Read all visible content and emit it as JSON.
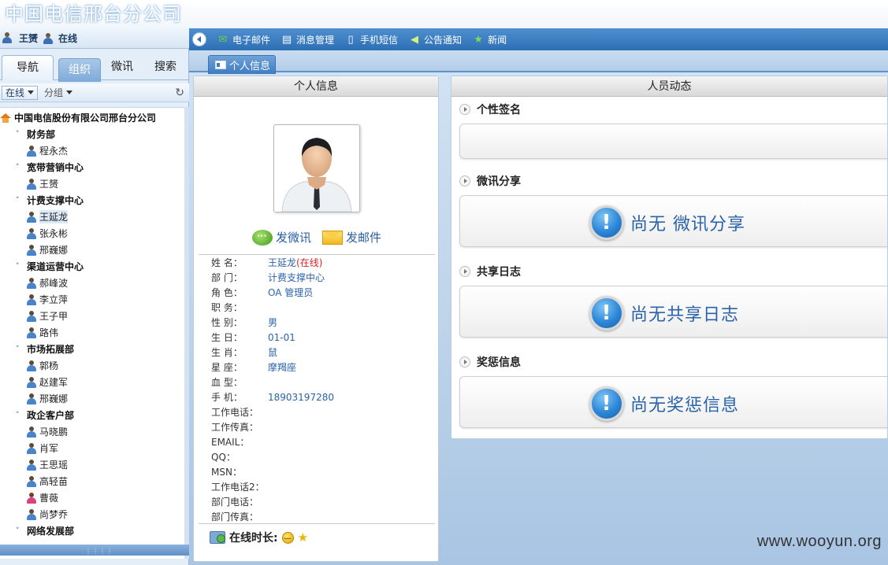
{
  "banner": {
    "title": "中国电信邢台分公司"
  },
  "user_bar": {
    "name": "王赟",
    "status": "在线"
  },
  "top_nav": {
    "items": [
      {
        "label": "电子邮件",
        "icon": "mail-icon",
        "color": "#6bd04a"
      },
      {
        "label": "消息管理",
        "icon": "message-list-icon",
        "color": "#ffffff"
      },
      {
        "label": "手机短信",
        "icon": "phone-icon",
        "color": "#ffffff"
      },
      {
        "label": "公告通知",
        "icon": "announcement-icon",
        "color": "#d6f07a"
      },
      {
        "label": "新闻",
        "icon": "news-icon",
        "color": "#7fd65a"
      }
    ]
  },
  "sidebar": {
    "tabs": [
      "导航",
      "组织",
      "微讯",
      "搜索"
    ],
    "active_tab": "组织",
    "filter_status": "在线",
    "filter_group": "分组",
    "tree": {
      "root": "中国电信股份有限公司邢台分公司",
      "departments": [
        {
          "name": "财务部",
          "members": [
            {
              "name": "程永杰"
            }
          ]
        },
        {
          "name": "宽带营销中心",
          "members": [
            {
              "name": "王赟"
            }
          ]
        },
        {
          "name": "计费支撑中心",
          "members": [
            {
              "name": "王延龙",
              "selected": true
            },
            {
              "name": "张永彬"
            },
            {
              "name": "邢巍娜"
            }
          ]
        },
        {
          "name": "渠道运营中心",
          "members": [
            {
              "name": "郝峰波"
            },
            {
              "name": "李立萍"
            },
            {
              "name": "王子甲"
            },
            {
              "name": "路伟"
            }
          ]
        },
        {
          "name": "市场拓展部",
          "members": [
            {
              "name": "郭杨"
            },
            {
              "name": "赵建军"
            },
            {
              "name": "邢巍娜"
            }
          ]
        },
        {
          "name": "政企客户部",
          "members": [
            {
              "name": "马晓鹏"
            },
            {
              "name": "肖军"
            },
            {
              "name": "王思瑶"
            },
            {
              "name": "高轻苗"
            },
            {
              "name": "曹薇",
              "female": true
            },
            {
              "name": "尚梦乔"
            }
          ]
        },
        {
          "name": "网络发展部",
          "members": []
        }
      ]
    }
  },
  "content_tabs": [
    {
      "label": "个人信息"
    }
  ],
  "info_panel": {
    "title": "个人信息",
    "actions": {
      "weixun": "发微讯",
      "mail": "发邮件"
    },
    "fields": [
      {
        "label": "姓 名：",
        "value": "王延龙",
        "status": "(在线)"
      },
      {
        "label": "部 门：",
        "value": "计费支撑中心"
      },
      {
        "label": "角 色：",
        "value": "OA 管理员"
      },
      {
        "label": "职 务：",
        "value": ""
      },
      {
        "label": "性 别：",
        "value": "男"
      },
      {
        "label": "生 日：",
        "value": "01-01"
      },
      {
        "label": "生 肖：",
        "value": "鼠"
      },
      {
        "label": "星 座：",
        "value": "摩羯座"
      },
      {
        "label": "血 型：",
        "value": ""
      },
      {
        "label": "手 机：",
        "value": "18903197280"
      },
      {
        "label": "工作电话：",
        "value": ""
      },
      {
        "label": "工作传真：",
        "value": ""
      },
      {
        "label": "EMAIL：",
        "value": ""
      },
      {
        "label": "QQ：",
        "value": ""
      },
      {
        "label": "MSN：",
        "value": ""
      },
      {
        "label": "工作电话2：",
        "value": ""
      },
      {
        "label": "部门电话：",
        "value": ""
      },
      {
        "label": "部门传真：",
        "value": ""
      }
    ],
    "online_label": "在线时长:"
  },
  "activity_panel": {
    "title": "人员动态",
    "sections": [
      {
        "title": "个性签名",
        "message": ""
      },
      {
        "title": "微讯分享",
        "message": "尚无 微讯分享"
      },
      {
        "title": "共享日志",
        "message": "尚无共享日志"
      },
      {
        "title": "奖惩信息",
        "message": "尚无奖惩信息"
      }
    ]
  },
  "watermark": "www.wooyun.org"
}
